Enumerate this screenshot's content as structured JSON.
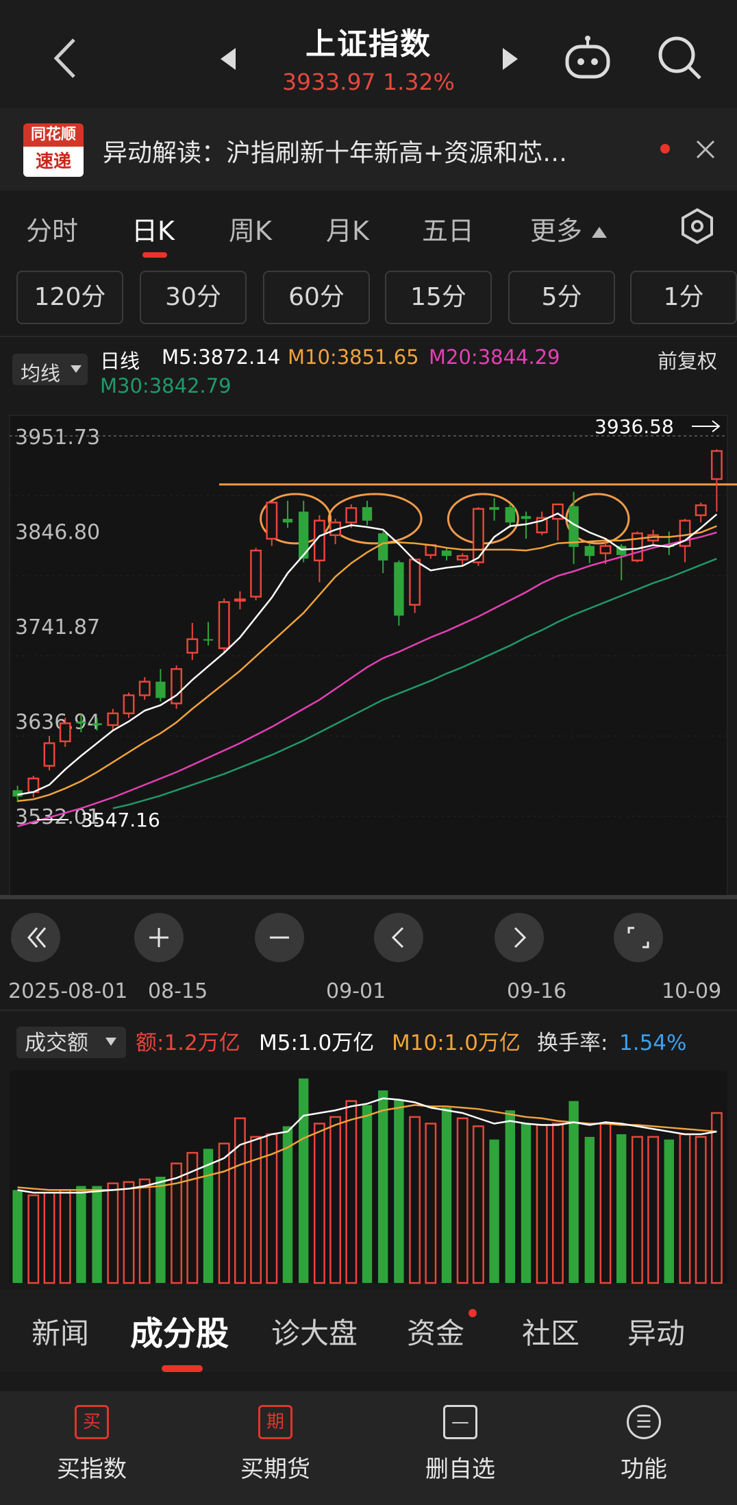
{
  "header": {
    "title": "上证指数",
    "subtitle": "3933.97 1.32%",
    "price_color": "#e5483e"
  },
  "banner": {
    "logo_line1": "同花顺",
    "logo_line2": "速递",
    "text": "异动解读：沪指刷新十年新高+资源和芯…"
  },
  "tabs": [
    "分时",
    "日K",
    "周K",
    "月K",
    "五日",
    "更多"
  ],
  "minute_buttons": [
    "120分",
    "30分",
    "60分",
    "15分",
    "5分",
    "1分"
  ],
  "indicators": {
    "selector": "均线",
    "period": "日线",
    "m5": "M5:3872.14",
    "m10": "M10:3851.65",
    "m20": "M20:3844.29",
    "m30": "M30:3842.79",
    "adjust": "前复权",
    "colors": {
      "m5": "#ffffff",
      "m10": "#f2a33a",
      "m20": "#e63fb6",
      "m30": "#1f9a6a"
    }
  },
  "chart_data": {
    "type": "candlestick",
    "price_ticks": [
      "3951.73",
      "3846.80",
      "3741.87",
      "3636.94",
      "3532.01"
    ],
    "ylim": [
      3532.01,
      3951.73
    ],
    "high_label": "3936.58",
    "low_label": "3547.16",
    "x_ticks": [
      "2025-08-01",
      "08-15",
      "09-01",
      "09-16",
      "10-09"
    ],
    "up_color": "#e8463a",
    "down_color": "#2ea43b",
    "candles": [
      {
        "o": 3560,
        "c": 3553,
        "h": 3565,
        "l": 3547
      },
      {
        "o": 3558,
        "c": 3573,
        "h": 3576,
        "l": 3552
      },
      {
        "o": 3587,
        "c": 3612,
        "h": 3620,
        "l": 3582
      },
      {
        "o": 3614,
        "c": 3634,
        "h": 3640,
        "l": 3608
      },
      {
        "o": 3636,
        "c": 3634,
        "h": 3644,
        "l": 3624
      },
      {
        "o": 3634,
        "c": 3632,
        "h": 3640,
        "l": 3626
      },
      {
        "o": 3632,
        "c": 3645,
        "h": 3650,
        "l": 3626
      },
      {
        "o": 3645,
        "c": 3665,
        "h": 3668,
        "l": 3640
      },
      {
        "o": 3665,
        "c": 3680,
        "h": 3685,
        "l": 3660
      },
      {
        "o": 3680,
        "c": 3662,
        "h": 3694,
        "l": 3658
      },
      {
        "o": 3656,
        "c": 3694,
        "h": 3698,
        "l": 3650
      },
      {
        "o": 3712,
        "c": 3727,
        "h": 3745,
        "l": 3704
      },
      {
        "o": 3727,
        "c": 3726,
        "h": 3746,
        "l": 3720
      },
      {
        "o": 3717,
        "c": 3768,
        "h": 3772,
        "l": 3711
      },
      {
        "o": 3770,
        "c": 3771,
        "h": 3780,
        "l": 3760
      },
      {
        "o": 3774,
        "c": 3825,
        "h": 3828,
        "l": 3770
      },
      {
        "o": 3838,
        "c": 3878,
        "h": 3878,
        "l": 3830
      },
      {
        "o": 3860,
        "c": 3856,
        "h": 3880,
        "l": 3850
      },
      {
        "o": 3868,
        "c": 3816,
        "h": 3880,
        "l": 3812
      },
      {
        "o": 3814,
        "c": 3858,
        "h": 3864,
        "l": 3790
      },
      {
        "o": 3842,
        "c": 3856,
        "h": 3860,
        "l": 3832
      },
      {
        "o": 3856,
        "c": 3872,
        "h": 3876,
        "l": 3850
      },
      {
        "o": 3873,
        "c": 3858,
        "h": 3880,
        "l": 3853
      },
      {
        "o": 3844,
        "c": 3814,
        "h": 3846,
        "l": 3800
      },
      {
        "o": 3812,
        "c": 3753,
        "h": 3814,
        "l": 3742
      },
      {
        "o": 3765,
        "c": 3815,
        "h": 3816,
        "l": 3756
      },
      {
        "o": 3820,
        "c": 3831,
        "h": 3832,
        "l": 3816
      },
      {
        "o": 3825,
        "c": 3819,
        "h": 3829,
        "l": 3814
      },
      {
        "o": 3815,
        "c": 3819,
        "h": 3822,
        "l": 3808
      },
      {
        "o": 3812,
        "c": 3871,
        "h": 3873,
        "l": 3808
      },
      {
        "o": 3873,
        "c": 3870,
        "h": 3883,
        "l": 3858
      },
      {
        "o": 3873,
        "c": 3856,
        "h": 3876,
        "l": 3850
      },
      {
        "o": 3863,
        "c": 3860,
        "h": 3868,
        "l": 3838
      },
      {
        "o": 3845,
        "c": 3861,
        "h": 3868,
        "l": 3842
      },
      {
        "o": 3860,
        "c": 3876,
        "h": 3877,
        "l": 3836
      },
      {
        "o": 3874,
        "c": 3829,
        "h": 3890,
        "l": 3810
      },
      {
        "o": 3830,
        "c": 3819,
        "h": 3832,
        "l": 3811
      },
      {
        "o": 3822,
        "c": 3830,
        "h": 3834,
        "l": 3810
      },
      {
        "o": 3830,
        "c": 3820,
        "h": 3832,
        "l": 3792
      },
      {
        "o": 3814,
        "c": 3844,
        "h": 3846,
        "l": 3812
      },
      {
        "o": 3836,
        "c": 3842,
        "h": 3848,
        "l": 3832
      },
      {
        "o": 3832,
        "c": 3829,
        "h": 3846,
        "l": 3820
      },
      {
        "o": 3830,
        "c": 3858,
        "h": 3860,
        "l": 3812
      },
      {
        "o": 3864,
        "c": 3875,
        "h": 3878,
        "l": 3856
      },
      {
        "o": 3904,
        "c": 3935,
        "h": 3937,
        "l": 3868
      }
    ],
    "ma5": [
      3555,
      3558,
      3566,
      3583,
      3598,
      3612,
      3626,
      3636,
      3648,
      3654,
      3665,
      3682,
      3697,
      3712,
      3729,
      3751,
      3773,
      3800,
      3820,
      3841,
      3848,
      3853,
      3851,
      3848,
      3832,
      3814,
      3803,
      3806,
      3808,
      3817,
      3840,
      3852,
      3854,
      3858,
      3866,
      3854,
      3845,
      3838,
      3826,
      3827,
      3831,
      3829,
      3836,
      3850,
      3865
    ],
    "ma10": [
      3548,
      3550,
      3555,
      3562,
      3570,
      3580,
      3591,
      3602,
      3613,
      3623,
      3635,
      3650,
      3664,
      3678,
      3692,
      3708,
      3724,
      3740,
      3756,
      3776,
      3796,
      3811,
      3823,
      3833,
      3834,
      3833,
      3831,
      3828,
      3826,
      3826,
      3826,
      3826,
      3825,
      3828,
      3833,
      3834,
      3835,
      3836,
      3836,
      3838,
      3840,
      3840,
      3842,
      3845,
      3852
    ],
    "ma20": [
      3520,
      3525,
      3530,
      3535,
      3540,
      3546,
      3552,
      3559,
      3566,
      3573,
      3580,
      3588,
      3596,
      3604,
      3612,
      3621,
      3630,
      3640,
      3650,
      3660,
      3672,
      3684,
      3696,
      3706,
      3713,
      3721,
      3729,
      3736,
      3744,
      3752,
      3761,
      3770,
      3779,
      3789,
      3797,
      3802,
      3808,
      3813,
      3818,
      3823,
      3828,
      3832,
      3836,
      3840,
      3845
    ],
    "ma30": [
      null,
      null,
      null,
      null,
      null,
      null,
      3540,
      3544,
      3549,
      3554,
      3560,
      3566,
      3572,
      3578,
      3585,
      3592,
      3599,
      3607,
      3615,
      3624,
      3633,
      3642,
      3651,
      3660,
      3667,
      3674,
      3681,
      3689,
      3696,
      3704,
      3712,
      3720,
      3729,
      3737,
      3746,
      3754,
      3761,
      3768,
      3775,
      3782,
      3789,
      3795,
      3802,
      3809,
      3816
    ],
    "resistance_level": 3898,
    "volume": {
      "label": "成交额",
      "amount": "额:1.2万亿",
      "m5": "M5:1.0万亿",
      "m10": "M10:1.0万亿",
      "turnover_label": "换手率:",
      "turnover_value": "1.54%",
      "values": [
        0.7,
        0.66,
        0.68,
        0.7,
        0.73,
        0.73,
        0.75,
        0.76,
        0.78,
        0.8,
        0.9,
        0.98,
        1.01,
        1.05,
        1.24,
        1.1,
        1.12,
        1.18,
        1.54,
        1.2,
        1.25,
        1.37,
        1.34,
        1.45,
        1.38,
        1.25,
        1.2,
        1.32,
        1.24,
        1.18,
        1.08,
        1.3,
        1.2,
        1.19,
        1.2,
        1.37,
        1.1,
        1.2,
        1.12,
        1.1,
        1.1,
        1.08,
        1.12,
        1.1,
        1.28
      ],
      "vol_ma5": [
        0.7,
        0.68,
        0.68,
        0.68,
        0.68,
        0.69,
        0.7,
        0.71,
        0.73,
        0.76,
        0.79,
        0.84,
        0.89,
        0.94,
        1.04,
        1.08,
        1.12,
        1.14,
        1.26,
        1.28,
        1.3,
        1.33,
        1.35,
        1.39,
        1.38,
        1.36,
        1.32,
        1.3,
        1.28,
        1.24,
        1.2,
        1.22,
        1.2,
        1.19,
        1.19,
        1.21,
        1.19,
        1.21,
        1.2,
        1.18,
        1.16,
        1.14,
        1.12,
        1.12,
        1.14
      ],
      "vol_ma10": [
        0.72,
        0.71,
        0.7,
        0.7,
        0.7,
        0.7,
        0.7,
        0.71,
        0.72,
        0.73,
        0.75,
        0.78,
        0.81,
        0.84,
        0.89,
        0.93,
        0.97,
        1.02,
        1.09,
        1.14,
        1.19,
        1.23,
        1.26,
        1.3,
        1.32,
        1.34,
        1.33,
        1.33,
        1.32,
        1.31,
        1.29,
        1.27,
        1.25,
        1.24,
        1.22,
        1.21,
        1.2,
        1.2,
        1.19,
        1.19,
        1.18,
        1.17,
        1.16,
        1.15,
        1.14
      ]
    }
  },
  "subnav": [
    "新闻",
    "成分股",
    "诊大盘",
    "资金",
    "社区",
    "异动"
  ],
  "toolbar": [
    {
      "icon": "买",
      "label": "买指数"
    },
    {
      "icon": "期",
      "label": "买期货"
    },
    {
      "icon": "—",
      "label": "删自选"
    },
    {
      "icon": "☰",
      "label": "功能"
    }
  ]
}
